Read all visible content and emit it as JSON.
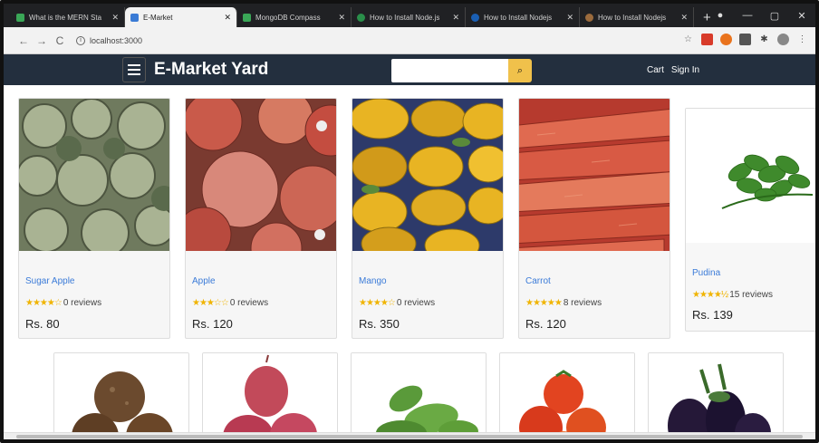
{
  "browser": {
    "tabs": [
      {
        "title": "What is the MERN Sta",
        "color": "#3aa757"
      },
      {
        "title": "E-Market",
        "color": "#3a7bd5"
      },
      {
        "title": "MongoDB Compass",
        "color": "#3aa757"
      },
      {
        "title": "How to Install Node.js",
        "color": "#2a8f4a"
      },
      {
        "title": "How to Install Nodejs",
        "color": "#1a5fb4"
      },
      {
        "title": "How to Install Nodejs",
        "color": "#9b6b3d"
      }
    ],
    "new_tab": "+",
    "window_controls": [
      "—",
      "▢",
      "✕"
    ],
    "url": "localhost:3000"
  },
  "header": {
    "brand": "E-Market Yard",
    "search_placeholder": "",
    "search_icon": "search-icon",
    "nav": {
      "cart": "Cart",
      "signin": "Sign In"
    }
  },
  "products": [
    {
      "name": "Sugar Apple",
      "stars": "★★★★☆",
      "reviews": "0 reviews",
      "price": "Rs. 80",
      "image": "sugar-apple"
    },
    {
      "name": "Apple",
      "stars": "★★★☆☆",
      "reviews": "0 reviews",
      "price": "Rs. 120",
      "image": "apple"
    },
    {
      "name": "Mango",
      "stars": "★★★★☆",
      "reviews": "0 reviews",
      "price": "Rs. 350",
      "image": "mango"
    },
    {
      "name": "Carrot",
      "stars": "★★★★★",
      "reviews": "8 reviews",
      "price": "Rs. 120",
      "image": "carrot"
    },
    {
      "name": "Pudina",
      "stars": "★★★★½",
      "reviews": "15 reviews",
      "price": "Rs. 139",
      "image": "pudina"
    }
  ],
  "products_row2": [
    {
      "image": "beetroot"
    },
    {
      "image": "onion"
    },
    {
      "image": "cucumber"
    },
    {
      "image": "tomato"
    },
    {
      "image": "brinjal"
    }
  ],
  "colors": {
    "header_bg": "#232f3e",
    "search_button": "#f0c14b",
    "product_link": "#3b7bd8",
    "star": "#f0b400"
  }
}
